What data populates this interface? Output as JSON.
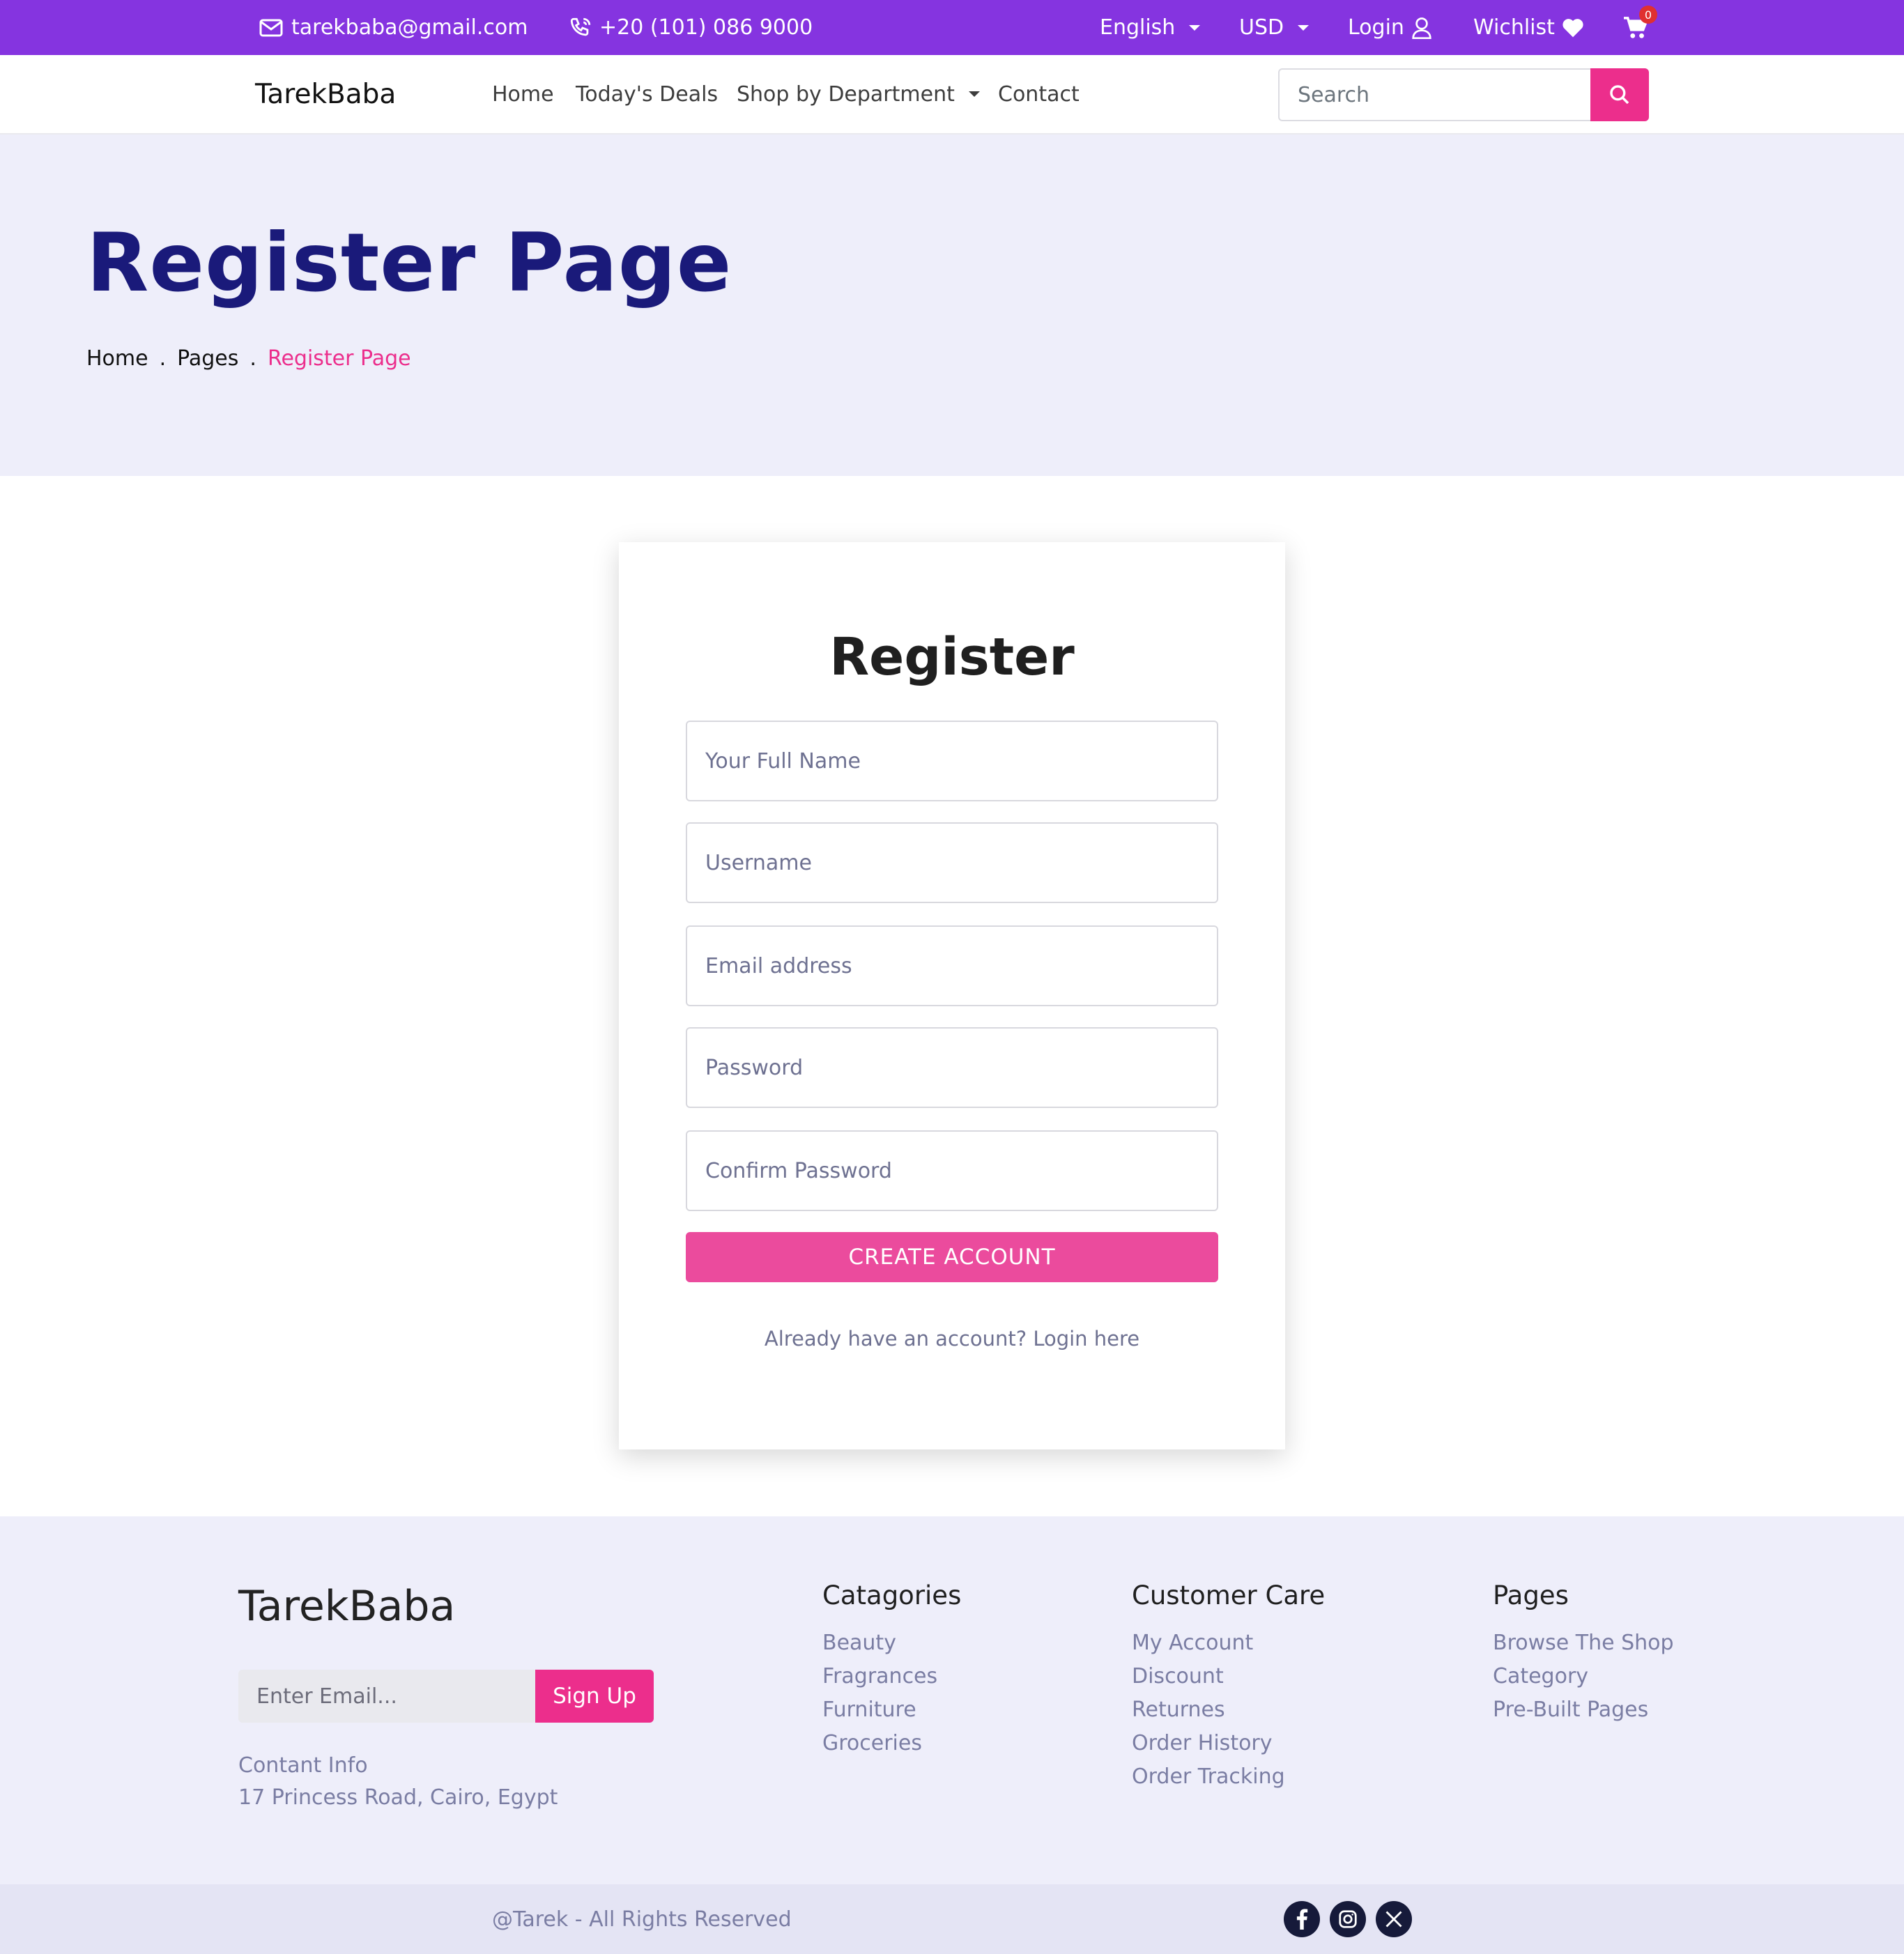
{
  "topbar": {
    "email": "tarekbaba@gmail.com",
    "phone": "+20 (101) 086 9000",
    "language": "English",
    "currency": "USD",
    "login": "Login",
    "wishlist": "Wichlist",
    "cart_count": "0",
    "icons": [
      "envelope-icon",
      "phone-icon",
      "user-icon",
      "heart-icon",
      "cart-icon"
    ]
  },
  "navbar": {
    "brand": "TarekBaba",
    "links": [
      "Home",
      "Today's Deals",
      "Shop by Department",
      "Contact"
    ],
    "search_placeholder": "Search"
  },
  "hero": {
    "title": "Register Page",
    "breadcrumb": [
      "Home",
      "Pages",
      "Register Page"
    ],
    "separator": "."
  },
  "register": {
    "title": "Register",
    "fields": [
      {
        "placeholder": "Your Full Name",
        "value": ""
      },
      {
        "placeholder": "Username",
        "value": ""
      },
      {
        "placeholder": "Email address",
        "value": ""
      },
      {
        "placeholder": "Password",
        "value": ""
      },
      {
        "placeholder": "Confirm Password",
        "value": ""
      }
    ],
    "submit": "CREATE ACCOUNT",
    "login_prompt": "Already have an account? Login here"
  },
  "footer": {
    "brand": "TarekBaba",
    "email_placeholder": "Enter Email...",
    "signup": "Sign Up",
    "contact_label": "Contant Info",
    "address": "17 Princess Road, Cairo, Egypt",
    "columns": [
      {
        "title": "Catagories",
        "items": [
          "Beauty",
          "Fragrances",
          "Furniture",
          "Groceries"
        ]
      },
      {
        "title": "Customer Care",
        "items": [
          "My Account",
          "Discount",
          "Returnes",
          "Order History",
          "Order Tracking"
        ]
      },
      {
        "title": "Pages",
        "items": [
          "Browse The Shop",
          "Category",
          "Pre-Built Pages"
        ]
      }
    ],
    "rights": "@Tarek - All Rights Reserved",
    "social_icons": [
      "facebook-icon",
      "instagram-icon",
      "x-icon"
    ]
  },
  "colors": {
    "topbar": "#8534e0",
    "accent": "#ec2e8c",
    "hero_bg": "#eeeefa",
    "hero_title": "#1a1a7a",
    "muted_text": "#7a7da3"
  }
}
